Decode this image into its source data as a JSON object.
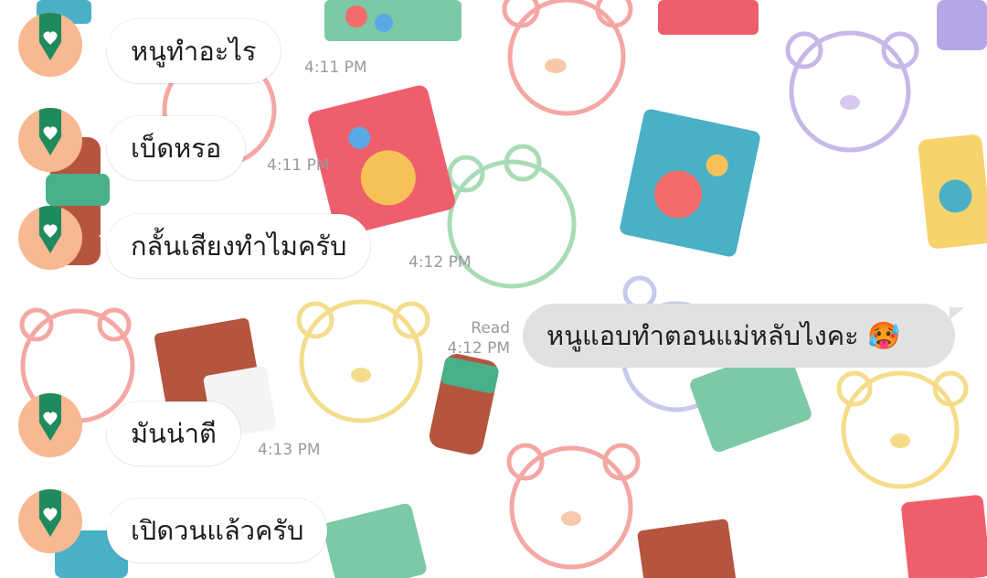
{
  "chat": {
    "messages": [
      {
        "direction": "incoming",
        "text": "หนูทำอะไร",
        "time": "4:11 PM"
      },
      {
        "direction": "incoming",
        "text": "เบ็ดหรอ",
        "time": "4:11 PM"
      },
      {
        "direction": "incoming",
        "text": "กลั้นเสียงทำไมครับ",
        "time": "4:12 PM"
      },
      {
        "direction": "outgoing",
        "text": "หนูแอบทำตอนแม่หลับไงคะ 🥵",
        "status": "Read",
        "time": "4:12 PM"
      },
      {
        "direction": "incoming",
        "text": "มันน่าตี",
        "time": "4:13 PM"
      },
      {
        "direction": "incoming",
        "text": "เปิดวนแล้วครับ",
        "time": ""
      }
    ],
    "avatar_icon": "green-pencil-heart-icon",
    "colors": {
      "avatar_bg": "#f7b892",
      "avatar_pencil": "#1f8a5c",
      "incoming_bubble": "#ffffff",
      "outgoing_bubble": "#e1e1e1",
      "timestamp": "#9a9a9a"
    },
    "wallpaper_theme": "bear-and-candy-doodles"
  }
}
